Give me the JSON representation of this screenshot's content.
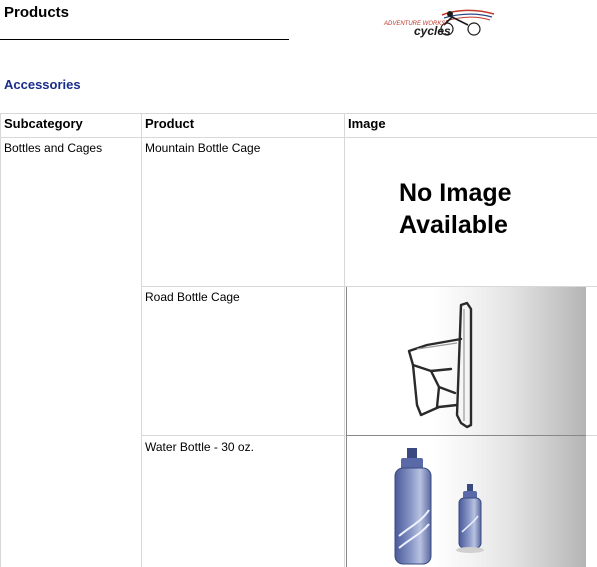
{
  "header": {
    "title": "Products",
    "logo_top": "ADVENTURE WORKS",
    "logo_bottom": "cycles"
  },
  "category": "Accessories",
  "table": {
    "columns": [
      "Subcategory",
      "Product",
      "Image"
    ],
    "subcategory": "Bottles and Cages",
    "rows": [
      {
        "product": "Mountain Bottle Cage",
        "image": "no-image",
        "no_image_line1": "No Image",
        "no_image_line2": "Available"
      },
      {
        "product": "Road Bottle Cage",
        "image": "bottle-cage-photo"
      },
      {
        "product": "Water Bottle - 30 oz.",
        "image": "water-bottle-photo"
      }
    ]
  },
  "colors": {
    "category_text": "#1a2d8a",
    "grid_line": "#d8d8d8",
    "logo_red": "#c0392b",
    "logo_blue": "#2f4a8a"
  }
}
